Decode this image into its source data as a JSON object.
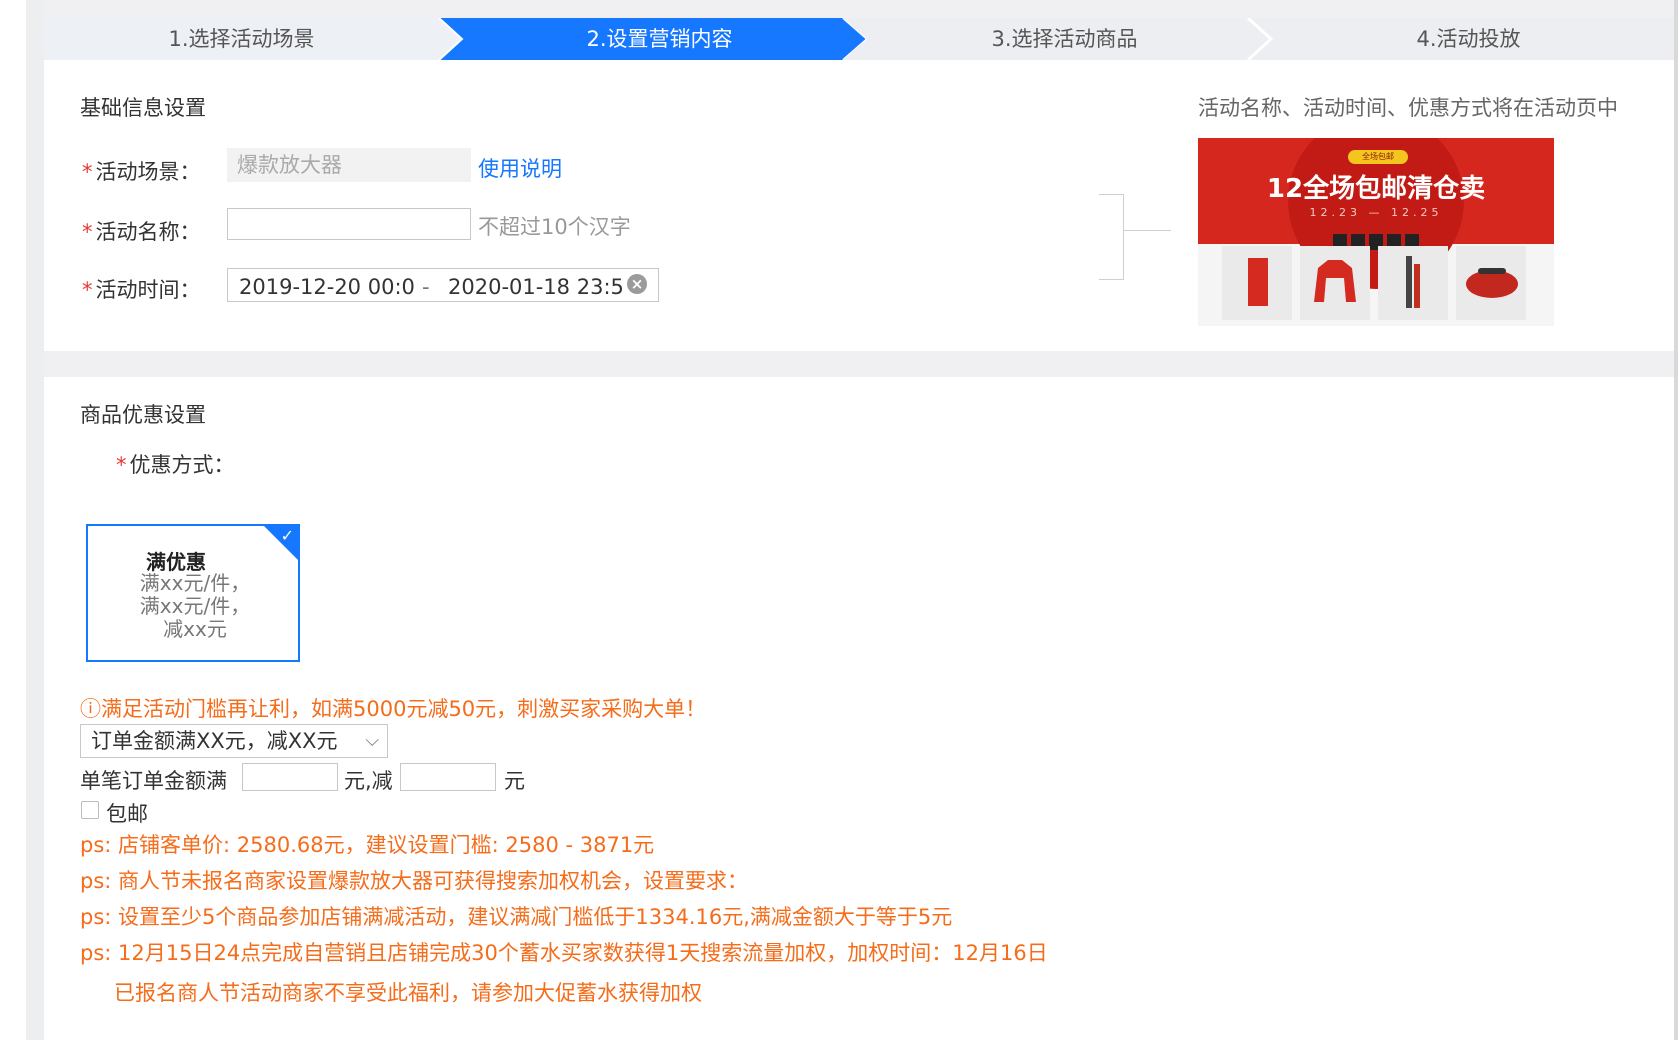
{
  "steps": [
    {
      "label": "1.选择活动场景"
    },
    {
      "label": "2.设置营销内容"
    },
    {
      "label": "3.选择活动商品"
    },
    {
      "label": "4.活动投放"
    }
  ],
  "basic": {
    "section_title": "基础信息设置",
    "scene_label": "活动场景：",
    "scene_value": "爆款放大器",
    "usage_link": "使用说明",
    "name_label": "活动名称：",
    "name_value": "",
    "name_hint": "不超过10个汉字",
    "time_label": "活动时间：",
    "time_start": "2019-12-20 00:0",
    "time_separator": "-",
    "time_end": "2020-01-18 23:5",
    "preview_note": "活动名称、活动时间、优惠方式将在活动页中",
    "banner_tag": "全场包邮",
    "banner_title": "12全场包邮清仓卖",
    "banner_dates": "12.23 — 12.25"
  },
  "discount": {
    "section_title": "商品优惠设置",
    "method_label": "优惠方式：",
    "option_title": "满优惠",
    "option_desc_1": "满xx元/件，",
    "option_desc_2": "满xx元/件，",
    "option_desc_3": "减xx元",
    "warn_text": "满足活动门槛再让利，如满5000元减50元，刺激买家采购大单！",
    "select_value": "订单金额满XX元，减XX元",
    "order_row_prefix": "单笔订单金额满",
    "order_row_mid": "元,减",
    "order_row_suffix": "元",
    "free_shipping_label": "包邮",
    "ps_lines": [
      "ps: 店铺客单价: 2580.68元，建议设置门槛: 2580 - 3871元",
      "ps: 商人节未报名商家设置爆款放大器可获得搜索加权机会，设置要求：",
      "ps: 设置至少5个商品参加店铺满减活动，建议满减门槛低于1334.16元,满减金额大于等于5元",
      "ps: 12月15日24点完成自营销且店铺完成30个蓄水买家数获得1天搜索流量加权，加权时间：12月16日"
    ],
    "ps_partial": "已报名商人节活动商家不享受此福利，请参加大促蓄水获得加权"
  },
  "colors": {
    "accent": "#1677ff",
    "warn": "#f56c1a",
    "required": "#e53935"
  }
}
